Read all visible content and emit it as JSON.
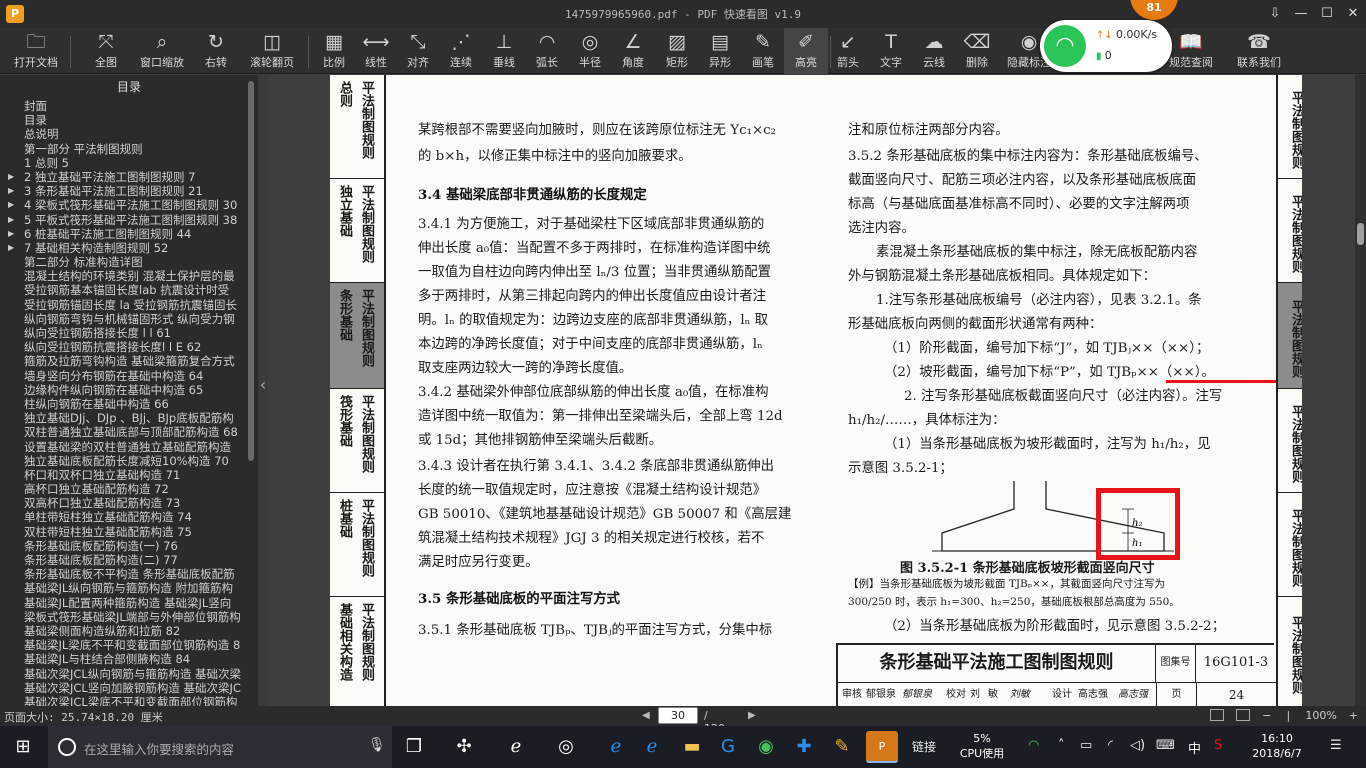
{
  "window": {
    "title": "1475979965960.pdf - PDF 快速看图 v1.9",
    "app_icon": "P",
    "badge": "81",
    "controls": [
      "⇩",
      "—",
      "☐",
      "✕"
    ]
  },
  "toolbar": {
    "items": [
      {
        "name": "open-file",
        "label": "打开文档",
        "icon": "🗀"
      },
      {
        "name": "full-view",
        "label": "全图",
        "icon": "⤧"
      },
      {
        "name": "window-zoom",
        "label": "窗口缩放",
        "icon": "⌕"
      },
      {
        "name": "rotate-right",
        "label": "右转",
        "icon": "↻"
      },
      {
        "name": "wheel-page",
        "label": "滚轮翻页",
        "icon": "◫"
      },
      {
        "name": "scale",
        "label": "比例",
        "icon": "▦"
      },
      {
        "name": "linear",
        "label": "线性",
        "icon": "⟷"
      },
      {
        "name": "aligned",
        "label": "对齐",
        "icon": "⤡"
      },
      {
        "name": "continuous",
        "label": "连续",
        "icon": "⋰"
      },
      {
        "name": "perpendicular",
        "label": "垂线",
        "icon": "⊥"
      },
      {
        "name": "arc-length",
        "label": "弧长",
        "icon": "◠"
      },
      {
        "name": "radius",
        "label": "半径",
        "icon": "◎"
      },
      {
        "name": "angle",
        "label": "角度",
        "icon": "∠"
      },
      {
        "name": "rectangle",
        "label": "矩形",
        "icon": "▨"
      },
      {
        "name": "irregular",
        "label": "异形",
        "icon": "▤"
      },
      {
        "name": "pen",
        "label": "画笔",
        "icon": "✎"
      },
      {
        "name": "highlight",
        "label": "高亮",
        "icon": "✐"
      },
      {
        "name": "arrow",
        "label": "箭头",
        "icon": "↙"
      },
      {
        "name": "text",
        "label": "文字",
        "icon": "T"
      },
      {
        "name": "cloud",
        "label": "云线",
        "icon": "☁"
      },
      {
        "name": "delete",
        "label": "删除",
        "icon": "⌫"
      },
      {
        "name": "hide-mark",
        "label": "隐藏标注",
        "icon": "◉"
      },
      {
        "name": "spec-lookup",
        "label": "规范查阅",
        "icon": "📖"
      },
      {
        "name": "contact-us",
        "label": "联系我们",
        "icon": "☎"
      }
    ]
  },
  "network_widget": {
    "speed": "0.00K/s",
    "count": "0"
  },
  "sidebar": {
    "title": "目录",
    "items": [
      {
        "label": "封面",
        "expandable": false
      },
      {
        "label": "目录",
        "expandable": false
      },
      {
        "label": "总说明",
        "expandable": false
      },
      {
        "label": "第一部分  平法制图规则",
        "expandable": false
      },
      {
        "label": "1 总则 5",
        "expandable": false
      },
      {
        "label": "2 独立基础平法施工图制图规则 7",
        "expandable": true
      },
      {
        "label": "3 条形基础平法施工图制图规则 21",
        "expandable": true
      },
      {
        "label": "4 梁板式筏形基础平法施工图制图规则 30",
        "expandable": true
      },
      {
        "label": "5 平板式筏形基础平法施工图制图规则 38",
        "expandable": true
      },
      {
        "label": "6 桩基础平法施工图制图规则 44",
        "expandable": true
      },
      {
        "label": "7 基础相关构造制图规则 52",
        "expandable": true
      },
      {
        "label": "第二部分  标准构造详图",
        "expandable": false
      },
      {
        "label": "混凝土结构的环境类别 混凝土保护层的最",
        "expandable": false
      },
      {
        "label": "受拉钢筋基本锚固长度lab 抗震设计时受",
        "expandable": false
      },
      {
        "label": "受拉钢筋锚固长度 la 受拉钢筋抗震锚固长",
        "expandable": false
      },
      {
        "label": "纵向钢筋弯钩与机械锚固形式 纵向受力钢",
        "expandable": false
      },
      {
        "label": "纵向受拉钢筋搭接长度 l l  61",
        "expandable": false
      },
      {
        "label": "纵向受拉钢筋抗震搭接长度l l E  62",
        "expandable": false
      },
      {
        "label": "箍筋及拉筋弯钩构造 基础梁箍筋复合方式",
        "expandable": false
      },
      {
        "label": "墙身竖向分布钢筋在基础中构造 64",
        "expandable": false
      },
      {
        "label": "边缘构件纵向钢筋在基础中构造 65",
        "expandable": false
      },
      {
        "label": "柱纵向钢筋在基础中构造 66",
        "expandable": false
      },
      {
        "label": "独立基础DJj、DJp 、BJj、BJp底板配筋构",
        "expandable": false
      },
      {
        "label": "双柱普通独立基础底部与顶部配筋构造 68",
        "expandable": false
      },
      {
        "label": "设置基础梁的双柱普通独立基础配筋构造",
        "expandable": false
      },
      {
        "label": "独立基础底板配筋长度减短10%构造 70",
        "expandable": false
      },
      {
        "label": "杯口和双杯口独立基础构造 71",
        "expandable": false
      },
      {
        "label": "高杯口独立基础配筋构造 72",
        "expandable": false
      },
      {
        "label": "双高杯口独立基础配筋构造 73",
        "expandable": false
      },
      {
        "label": "单柱带短柱独立基础配筋构造 74",
        "expandable": false
      },
      {
        "label": "双柱带短柱独立基础配筋构造 75",
        "expandable": false
      },
      {
        "label": "条形基础底板配筋构造(一) 76",
        "expandable": false
      },
      {
        "label": "条形基础底板配筋构造(二) 77",
        "expandable": false
      },
      {
        "label": "条形基础底板不平构造 条形基础底板配筋",
        "expandable": false
      },
      {
        "label": "基础梁JL纵向钢筋与箍筋构造 附加箍筋构",
        "expandable": false
      },
      {
        "label": "基础梁JL配置两种箍筋构造 基础梁JL竖向",
        "expandable": false
      },
      {
        "label": "梁板式筏形基础梁JL端部与外伸部位钢筋构",
        "expandable": false
      },
      {
        "label": "基础梁侧面构造纵筋和拉筋 82",
        "expandable": false
      },
      {
        "label": "基础梁JL梁底不平和变截面部位钢筋构造 8",
        "expandable": false
      },
      {
        "label": "基础梁JL与柱结合部侧腋构造 84",
        "expandable": false
      },
      {
        "label": "基础次梁JCL纵向钢筋与箍筋构造 基础次梁",
        "expandable": false
      },
      {
        "label": "基础次梁JCL竖向加腋钢筋构造 基础次梁JC",
        "expandable": false
      },
      {
        "label": "基础次梁JCL梁底不平和变截面部位钢筋构",
        "expandable": false
      }
    ]
  },
  "page": {
    "left_tabs": [
      {
        "col1": "总则",
        "col2": "平法制图规则"
      },
      {
        "col1": "独立基础",
        "col2": "平法制图规则"
      },
      {
        "col1": "条形基础",
        "col2": "平法制图规则"
      },
      {
        "col1": "筏形基础",
        "col2": "平法制图规则"
      },
      {
        "col1": "桩基础",
        "col2": "平法制图规则"
      },
      {
        "col1": "基础相关构造",
        "col2": "平法制图规则"
      }
    ],
    "right_tabs": [
      "平法制图规则",
      "平法制图规则",
      "平法制图规则",
      "平法制图规则",
      "平法制图规则",
      "平法制图规则"
    ],
    "left_column": {
      "p1_line1": "某跨根部不需要竖向加腋时，则应在该跨原位标注无 Yc₁×c₂",
      "p1_line2": "的 b×h，以修正集中标注中的竖向加腋要求。",
      "h34": "3.4 基础梁底部非贯通纵筋的长度规定",
      "p341": [
        "3.4.1 为方便施工，对于基础梁柱下区域底部非贯通纵筋的",
        "伸出长度 a₀值：当配置不多于两排时，在标准构造详图中统",
        "一取值为自柱边向跨内伸出至 lₙ/3 位置；当非贯通纵筋配置",
        "多于两排时，从第三排起向跨内的伸出长度值应由设计者注",
        "明。lₙ 的取值规定为：边跨边支座的底部非贯通纵筋，lₙ 取",
        "本边跨的净跨长度值；对于中间支座的底部非贯通纵筋，lₙ",
        "取支座两边较大一跨的净跨长度值。"
      ],
      "p342": [
        "3.4.2 基础梁外伸部位底部纵筋的伸出长度 a₀值，在标准构",
        "造详图中统一取值为：第一排伸出至梁端头后，全部上弯 12d",
        "或 15d；其他排钢筋伸至梁端头后截断。"
      ],
      "p343": [
        "3.4.3 设计者在执行第 3.4.1、3.4.2 条底部非贯通纵筋伸出",
        "长度的统一取值规定时，应注意按《混凝土结构设计规范》",
        "GB 50010、《建筑地基基础设计规范》GB 50007 和《高层建",
        "筑混凝土结构技术规程》JGJ 3 的相关规定进行校核，若不",
        "满足时应另行变更。"
      ],
      "h35": "3.5 条形基础底板的平面注写方式",
      "p351": "3.5.1 条形基础底板 TJBₚ、TJBⱼ的平面注写方式，分集中标"
    },
    "right_column": {
      "lines": [
        "注和原位标注两部分内容。",
        "3.5.2 条形基础底板的集中标注内容为：条形基础底板编号、",
        "截面竖向尺寸、配筋三项必注内容，以及条形基础底板底面",
        "标高（与基础底面基准标高不同时）、必要的文字注解两项",
        "选注内容。",
        "素混凝土条形基础底板的集中标注，除无底板配筋内容",
        "外与钢筋混凝土条形基础底板相同。具体规定如下：",
        "1.注写条形基础底板编号（必注内容），见表 3.2.1。条",
        "形基础底板向两侧的截面形状通常有两种：",
        "（1）阶形截面，编号加下标“J”，如 TJBⱼ××（××）；",
        "（2）坡形截面，编号加下标“P”，如 TJBₚ××（××）。",
        "2. 注写条形基础底板截面竖向尺寸（必注内容）。注写",
        "h₁/h₂/……，具体标注为：",
        "（1）当条形基础底板为坡形截面时，注写为 h₁/h₂，见",
        "示意图 3.5.2-1；"
      ],
      "fig_caption": "图 3.5.2-1  条形基础底板坡形截面竖向尺寸",
      "example_line1": "【例】当条形基础底板为坡形截面 TJBₚ××，其截面竖向尺寸注写为",
      "example_line2": "300/250 时，表示 h₁=300、h₂=250，基础底板根部总高度为 550。",
      "last_line": "（2）当条形基础底板为阶形截面时，见示意图 3.5.2-2；",
      "fig_h1": "h₁",
      "fig_h2": "h₂"
    },
    "title_block": {
      "title": "条形基础平法施工图制图规则",
      "atlas_label": "图集号",
      "atlas": "16G101-3",
      "row2": [
        "审核",
        "郁银泉",
        "校对",
        "刘",
        "敏",
        "设计",
        "高志强"
      ],
      "page_label": "页",
      "page_num": "24"
    }
  },
  "statusbar": {
    "page_size": "页面大小: 25.74×18.20 厘米",
    "current_page": "30",
    "total_pages": "/ 120",
    "zoom": "100%"
  },
  "taskbar": {
    "search_placeholder": "在这里输入你要搜索的内容",
    "tray_link": "链接",
    "cpu_percent": "5%",
    "cpu_label": "CPU使用",
    "ime": "中",
    "time": "16:10",
    "date": "2018/6/7"
  }
}
